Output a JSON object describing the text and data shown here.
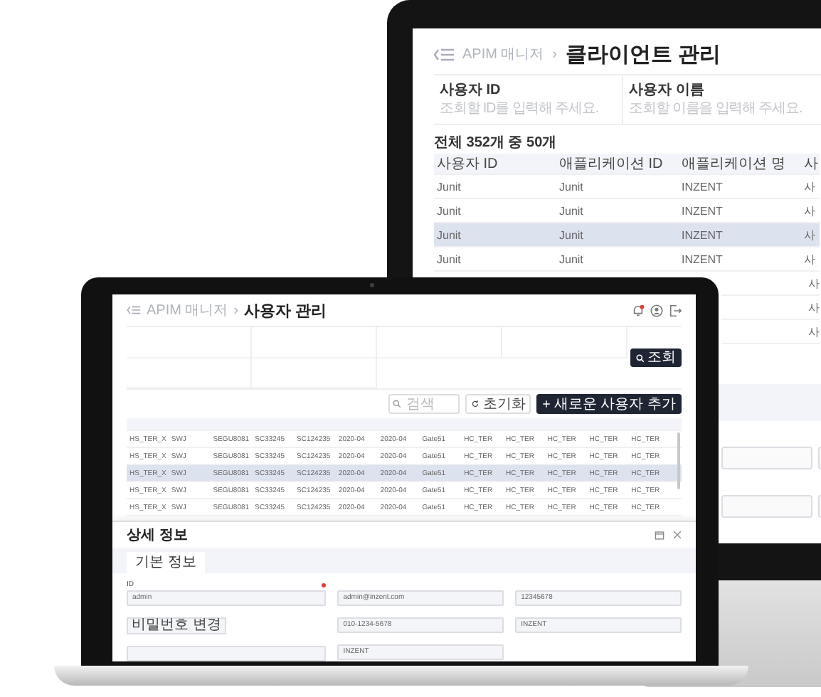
{
  "monitor": {
    "breadcrumb": "APIM 매니저",
    "separator": "›",
    "title": "클라이언트 관리",
    "filters": [
      {
        "label": "사용자 ID",
        "placeholder": "조회할 ID를 입력해 주세요."
      },
      {
        "label": "사용자 이름",
        "placeholder": "조회할 이름을 입력해 주세요."
      }
    ],
    "count": "전체 352개 중 50개",
    "table": {
      "columns": [
        "사용자 ID",
        "애플리케이션 ID",
        "애플리케이션 명",
        "사"
      ],
      "rows": [
        {
          "cells": [
            "Junit",
            "Junit",
            "INZENT",
            "사"
          ],
          "selected": false
        },
        {
          "cells": [
            "Junit",
            "Junit",
            "INZENT",
            "사"
          ],
          "selected": false
        },
        {
          "cells": [
            "Junit",
            "Junit",
            "INZENT",
            "사"
          ],
          "selected": true
        },
        {
          "cells": [
            "Junit",
            "Junit",
            "INZENT",
            "사"
          ],
          "selected": false
        },
        {
          "cells": [
            null,
            null,
            null,
            "사"
          ],
          "selected": false
        },
        {
          "cells": [
            null,
            null,
            null,
            "사"
          ],
          "selected": false
        },
        {
          "cells": [
            null,
            null,
            null,
            "사"
          ],
          "selected": false
        }
      ]
    }
  },
  "laptop": {
    "breadcrumb": "APIM 매니저",
    "separator": "›",
    "title": "사용자 관리",
    "notification": true,
    "search_button": "조회",
    "search": {
      "placeholder": "검색"
    },
    "reset_button": "초기화",
    "add_button": "새로운 사용자 추가",
    "table": {
      "rows": [
        {
          "cells": [
            "HS_TER_X",
            "SWJ",
            "SEGU8081",
            "SC33245",
            "SC124235",
            "2020-04",
            "2020-04",
            "Gate51",
            "HC_TER",
            "HC_TER",
            "HC_TER",
            "HC_TER",
            "HC_TER"
          ],
          "selected": false
        },
        {
          "cells": [
            "HS_TER_X",
            "SWJ",
            "SEGU8081",
            "SC33245",
            "SC124235",
            "2020-04",
            "2020-04",
            "Gate51",
            "HC_TER",
            "HC_TER",
            "HC_TER",
            "HC_TER",
            "HC_TER"
          ],
          "selected": false
        },
        {
          "cells": [
            "HS_TER_X",
            "SWJ",
            "SEGU8081",
            "SC33245",
            "SC124235",
            "2020-04",
            "2020-04",
            "Gate51",
            "HC_TER",
            "HC_TER",
            "HC_TER",
            "HC_TER",
            "HC_TER"
          ],
          "selected": true
        },
        {
          "cells": [
            "HS_TER_X",
            "SWJ",
            "SEGU8081",
            "SC33245",
            "SC124235",
            "2020-04",
            "2020-04",
            "Gate51",
            "HC_TER",
            "HC_TER",
            "HC_TER",
            "HC_TER",
            "HC_TER"
          ],
          "selected": false
        },
        {
          "cells": [
            "HS_TER_X",
            "SWJ",
            "SEGU8081",
            "SC33245",
            "SC124235",
            "2020-04",
            "2020-04",
            "Gate51",
            "HC_TER",
            "HC_TER",
            "HC_TER",
            "HC_TER",
            "HC_TER"
          ],
          "selected": false
        }
      ]
    },
    "detail": {
      "title": "상세 정보",
      "tabs": [
        {
          "label": "기본 정보",
          "selected": true
        }
      ],
      "columns": [
        [
          {
            "kind": "input",
            "label": "ID",
            "required": true,
            "value": "admin"
          },
          {
            "kind": "button",
            "label": "비밀번호 변경"
          },
          {
            "kind": "input"
          }
        ],
        [
          {
            "kind": "input",
            "value": "admin@inzent.com"
          },
          {
            "kind": "input",
            "value": "010-1234-5678"
          },
          {
            "kind": "input",
            "value": "INZENT"
          }
        ],
        [
          {
            "kind": "input",
            "value": "12345678"
          },
          {
            "kind": "input",
            "value": "INZENT"
          }
        ]
      ]
    }
  }
}
